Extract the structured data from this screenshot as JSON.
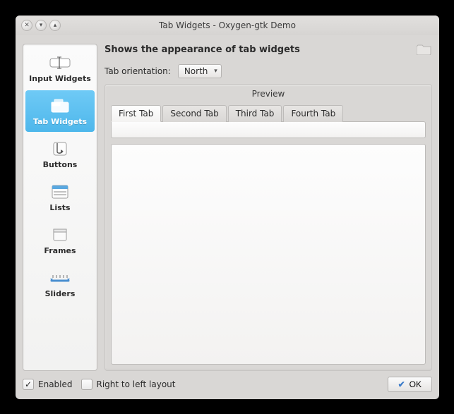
{
  "window": {
    "title": "Tab Widgets - Oxygen-gtk Demo"
  },
  "sidebar": {
    "items": [
      {
        "id": "input-widgets",
        "label": "Input Widgets",
        "icon": "input-widgets-icon",
        "selected": false
      },
      {
        "id": "tab-widgets",
        "label": "Tab Widgets",
        "icon": "tab-widgets-icon",
        "selected": true
      },
      {
        "id": "buttons",
        "label": "Buttons",
        "icon": "buttons-icon",
        "selected": false
      },
      {
        "id": "lists",
        "label": "Lists",
        "icon": "lists-icon",
        "selected": false
      },
      {
        "id": "frames",
        "label": "Frames",
        "icon": "frames-icon",
        "selected": false
      },
      {
        "id": "sliders",
        "label": "Sliders",
        "icon": "sliders-icon",
        "selected": false
      }
    ]
  },
  "header": {
    "title": "Shows the appearance of tab widgets"
  },
  "orientation": {
    "label": "Tab orientation:",
    "value": "North"
  },
  "preview": {
    "label": "Preview",
    "tabs": [
      {
        "label": "First Tab",
        "active": true
      },
      {
        "label": "Second Tab",
        "active": false
      },
      {
        "label": "Third Tab",
        "active": false
      },
      {
        "label": "Fourth Tab",
        "active": false
      }
    ]
  },
  "footer": {
    "enabled": {
      "label": "Enabled",
      "checked": true
    },
    "rtl": {
      "label": "Right to left layout",
      "checked": false
    },
    "ok_label": "OK"
  }
}
